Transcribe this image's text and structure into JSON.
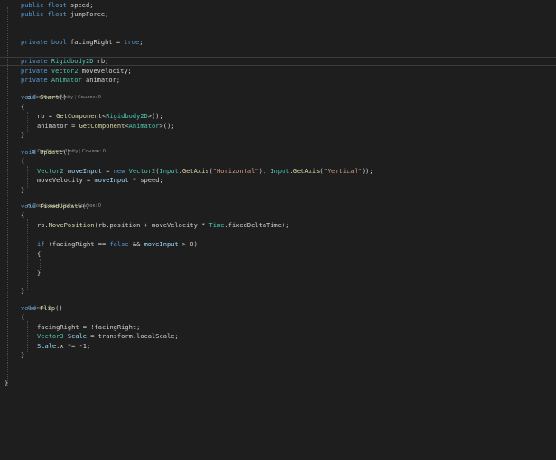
{
  "code_lines": {
    "l1": [
      {
        "t": "public float ",
        "c": "kw-mix",
        "parts": [
          [
            "public",
            "kw"
          ],
          [
            " ",
            "tx"
          ],
          [
            "float",
            "kw"
          ],
          [
            " speed;",
            "tx"
          ]
        ]
      }
    ],
    "l2": [],
    "l3": [],
    "l4": [],
    "l5": [],
    "l6": [],
    "l7": []
  },
  "lines": [
    {
      "id": "line-speed",
      "parts": [
        [
          "public",
          "kw"
        ],
        [
          " ",
          "tx"
        ],
        [
          "float",
          "kw"
        ],
        [
          " speed;",
          "tx"
        ]
      ]
    },
    {
      "id": "line-jumpforce",
      "parts": [
        [
          "public",
          "kw"
        ],
        [
          " ",
          "tx"
        ],
        [
          "float",
          "kw"
        ],
        [
          " jumpForce;",
          "tx"
        ]
      ]
    },
    {
      "id": "line-facingright",
      "parts": [
        [
          "private",
          "kw"
        ],
        [
          " ",
          "tx"
        ],
        [
          "bool",
          "kw"
        ],
        [
          " facingRight = ",
          "tx"
        ],
        [
          "true",
          "kw"
        ],
        [
          ";",
          "tx"
        ]
      ]
    },
    {
      "id": "line-rb",
      "parts": [
        [
          "private",
          "kw"
        ],
        [
          " ",
          "tx"
        ],
        [
          "Rigidbody2D",
          "ty"
        ],
        [
          " rb;",
          "tx"
        ]
      ]
    },
    {
      "id": "line-movevelocity",
      "parts": [
        [
          "private",
          "kw"
        ],
        [
          " ",
          "tx"
        ],
        [
          "Vector2",
          "ty"
        ],
        [
          " moveVelocity;",
          "tx"
        ]
      ]
    },
    {
      "id": "line-animator",
      "parts": [
        [
          "private",
          "kw"
        ],
        [
          " ",
          "tx"
        ],
        [
          "Animator",
          "ty"
        ],
        [
          " animator;",
          "tx"
        ]
      ]
    },
    {
      "id": "line-start-sig",
      "parts": [
        [
          "void",
          "kw"
        ],
        [
          " ",
          "tx"
        ],
        [
          "Start",
          "fn"
        ],
        [
          "()",
          "tx"
        ]
      ]
    },
    {
      "id": "line-start-open",
      "parts": [
        [
          "{",
          "tx"
        ]
      ]
    },
    {
      "id": "line-start-rb",
      "parts": [
        [
          "rb = ",
          "tx"
        ],
        [
          "GetComponent",
          "fn"
        ],
        [
          "<",
          "tx"
        ],
        [
          "Rigidbody2D",
          "ty"
        ],
        [
          ">();",
          "tx"
        ]
      ]
    },
    {
      "id": "line-start-animator",
      "parts": [
        [
          "animator = ",
          "tx"
        ],
        [
          "GetComponent",
          "fn"
        ],
        [
          "<",
          "tx"
        ],
        [
          "Animator",
          "ty"
        ],
        [
          ">();",
          "tx"
        ]
      ]
    },
    {
      "id": "line-start-close",
      "parts": [
        [
          "}",
          "tx"
        ]
      ]
    },
    {
      "id": "line-update-sig",
      "parts": [
        [
          "void",
          "kw"
        ],
        [
          " ",
          "tx"
        ],
        [
          "Update",
          "fn"
        ],
        [
          "()",
          "tx"
        ]
      ]
    },
    {
      "id": "line-update-open",
      "parts": [
        [
          "{",
          "tx"
        ]
      ]
    },
    {
      "id": "line-update-input",
      "parts": [
        [
          "Vector2",
          "ty"
        ],
        [
          " ",
          "tx"
        ],
        [
          "moveInput",
          "vr"
        ],
        [
          " = ",
          "tx"
        ],
        [
          "new",
          "kw"
        ],
        [
          " ",
          "tx"
        ],
        [
          "Vector2",
          "ty"
        ],
        [
          "(",
          "tx"
        ],
        [
          "Input",
          "ty"
        ],
        [
          ".",
          "tx"
        ],
        [
          "GetAxis",
          "fn"
        ],
        [
          "(",
          "tx"
        ],
        [
          "\"Horizontal\"",
          "st"
        ],
        [
          "), ",
          "tx"
        ],
        [
          "Input",
          "ty"
        ],
        [
          ".",
          "tx"
        ],
        [
          "GetAxis",
          "fn"
        ],
        [
          "(",
          "tx"
        ],
        [
          "\"Vertical\"",
          "st"
        ],
        [
          "));",
          "tx"
        ]
      ]
    },
    {
      "id": "line-update-velocity",
      "parts": [
        [
          "moveVelocity = ",
          "tx"
        ],
        [
          "moveInput",
          "vr"
        ],
        [
          " * speed;",
          "tx"
        ]
      ]
    },
    {
      "id": "line-update-close",
      "parts": [
        [
          "}",
          "tx"
        ]
      ]
    },
    {
      "id": "line-fixed-sig",
      "parts": [
        [
          "void",
          "kw"
        ],
        [
          " ",
          "tx"
        ],
        [
          "FixedUpdate",
          "fn"
        ],
        [
          "()",
          "tx"
        ]
      ]
    },
    {
      "id": "line-fixed-open",
      "parts": [
        [
          "{",
          "tx"
        ]
      ]
    },
    {
      "id": "line-fixed-move",
      "parts": [
        [
          "rb.",
          "tx"
        ],
        [
          "MovePosition",
          "fn"
        ],
        [
          "(rb.position + moveVelocity * ",
          "tx"
        ],
        [
          "Time",
          "ty"
        ],
        [
          ".fixedDeltaTime);",
          "tx"
        ]
      ]
    },
    {
      "id": "line-fixed-if",
      "parts": [
        [
          "if",
          "kw"
        ],
        [
          " (facingRight == ",
          "tx"
        ],
        [
          "false",
          "kw"
        ],
        [
          " && ",
          "tx"
        ],
        [
          "moveInput",
          "vr"
        ],
        [
          " > 0)",
          "tx"
        ]
      ]
    },
    {
      "id": "line-fixed-if-open",
      "parts": [
        [
          "{",
          "tx"
        ]
      ]
    },
    {
      "id": "line-fixed-if-close",
      "parts": [
        [
          "}",
          "tx"
        ]
      ]
    },
    {
      "id": "line-fixed-close",
      "parts": [
        [
          "}",
          "tx"
        ]
      ]
    },
    {
      "id": "line-flip-sig",
      "parts": [
        [
          "void",
          "kw"
        ],
        [
          " ",
          "tx"
        ],
        [
          "Flip",
          "fn"
        ],
        [
          "()",
          "tx"
        ]
      ]
    },
    {
      "id": "line-flip-open",
      "parts": [
        [
          "{",
          "tx"
        ]
      ]
    },
    {
      "id": "line-flip-toggle",
      "parts": [
        [
          "facingRight = !facingRight;",
          "tx"
        ]
      ]
    },
    {
      "id": "line-flip-scale",
      "parts": [
        [
          "Vector3",
          "ty"
        ],
        [
          " ",
          "tx"
        ],
        [
          "Scale",
          "vr"
        ],
        [
          " = transform.localScale;",
          "tx"
        ]
      ]
    },
    {
      "id": "line-flip-scalex",
      "parts": [
        [
          "Scale",
          "vr"
        ],
        [
          ".x *= -1;",
          "tx"
        ]
      ]
    },
    {
      "id": "line-flip-close",
      "parts": [
        [
          "}",
          "tx"
        ]
      ]
    },
    {
      "id": "line-class-close",
      "parts": [
        [
          "}",
          "tx"
        ]
      ]
    }
  ],
  "codelens": {
    "start": {
      "message": "Сообщение Unity",
      "refs": "Ссылок: 0"
    },
    "update": {
      "message": "Сообщение Unity",
      "refs": "Ссылок: 0"
    },
    "fixed": {
      "message": "Сообщение Unity",
      "refs": "Ссылок: 0"
    },
    "flip": {
      "refs": "Ссылок: 0"
    }
  },
  "colors": {
    "background": "#1e1e1e",
    "keyword": "#569cd6",
    "type": "#4ec9b0",
    "method": "#dcdcaa",
    "string": "#d69d85",
    "local_variable": "#9cdcfe",
    "text": "#d4d4d4"
  }
}
